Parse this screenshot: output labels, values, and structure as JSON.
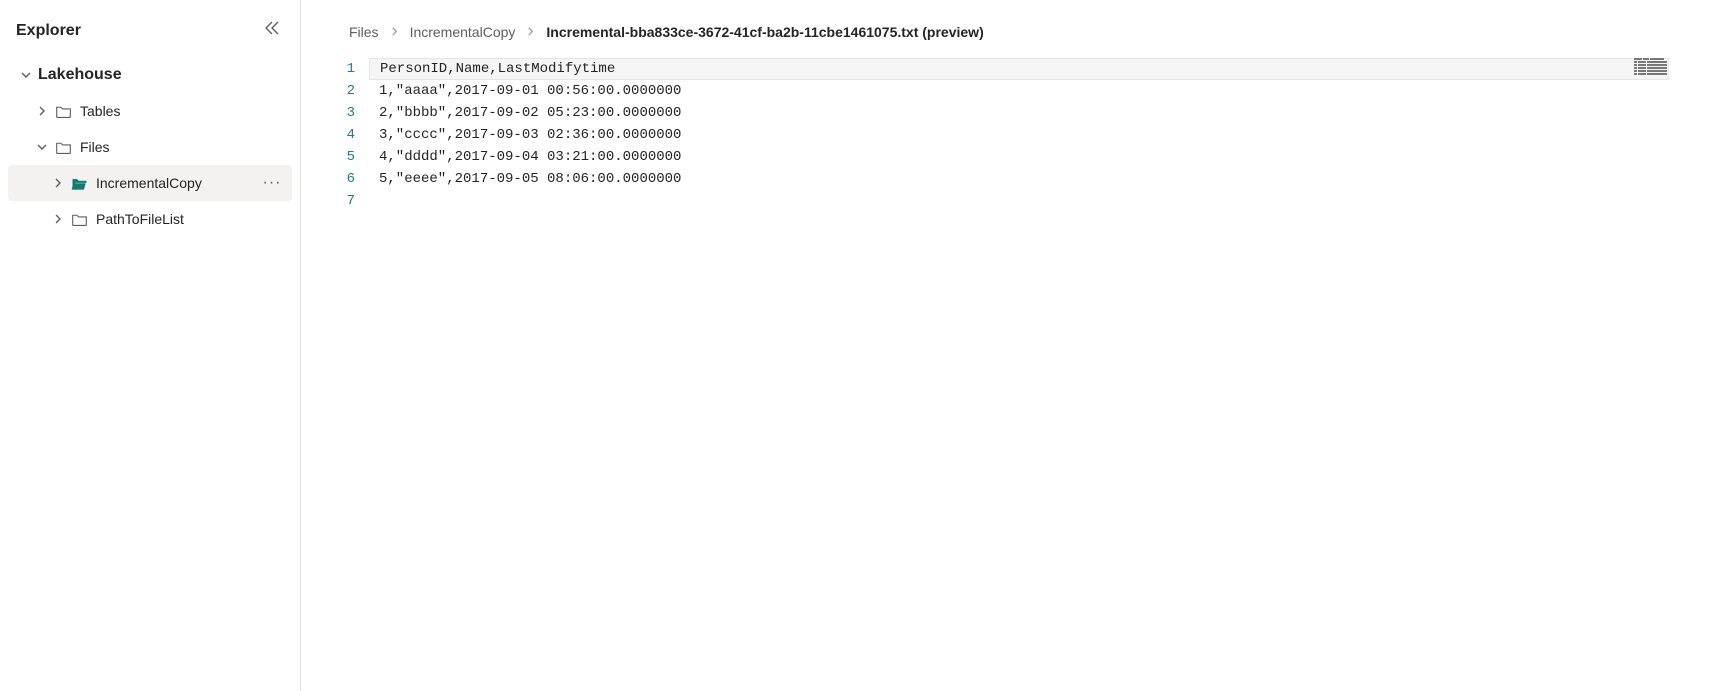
{
  "sidebar": {
    "title": "Explorer",
    "root": {
      "label": "Lakehouse",
      "items": [
        {
          "label": "Tables",
          "expanded": false,
          "indent": 1
        },
        {
          "label": "Files",
          "expanded": true,
          "indent": 1
        },
        {
          "label": "IncrementalCopy",
          "expanded": false,
          "indent": 2,
          "selected": true,
          "filled": true
        },
        {
          "label": "PathToFileList",
          "expanded": false,
          "indent": 2
        }
      ]
    }
  },
  "breadcrumb": {
    "items": [
      {
        "label": "Files",
        "current": false
      },
      {
        "label": "IncrementalCopy",
        "current": false
      },
      {
        "label": "Incremental-bba833ce-3672-41cf-ba2b-11cbe1461075.txt (preview)",
        "current": true
      }
    ]
  },
  "editor": {
    "lines": [
      "PersonID,Name,LastModifytime",
      "1,\"aaaa\",2017-09-01 00:56:00.0000000",
      "2,\"bbbb\",2017-09-02 05:23:00.0000000",
      "3,\"cccc\",2017-09-03 02:36:00.0000000",
      "4,\"dddd\",2017-09-04 03:21:00.0000000",
      "5,\"eeee\",2017-09-05 08:06:00.0000000",
      ""
    ],
    "current_line_index": 0,
    "gutter": [
      "1",
      "2",
      "3",
      "4",
      "5",
      "6",
      "7"
    ]
  }
}
